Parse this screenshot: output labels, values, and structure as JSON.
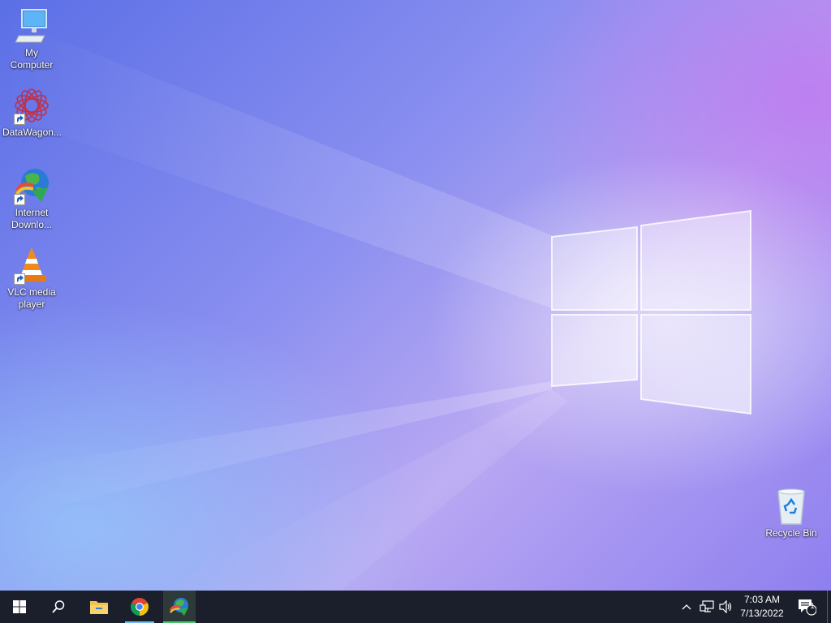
{
  "desktop": {
    "icons": [
      {
        "label": "My Computer"
      },
      {
        "label": "DataWagon..."
      },
      {
        "label_line1": "Internet",
        "label_line2": "Downlo..."
      },
      {
        "label_line1": "VLC media",
        "label_line2": "player"
      },
      {
        "label": "Recycle Bin"
      }
    ]
  },
  "taskbar": {
    "pinned": [
      "start-button",
      "search-button",
      "file-explorer",
      "chrome",
      "internet-download-manager"
    ],
    "clock": {
      "time": "7:03 AM",
      "date": "7/13/2022"
    },
    "notifications": {
      "count": "1"
    }
  },
  "colors": {
    "taskbar_bg": "#1b1e2b",
    "active_underline": "#4ac96a",
    "chrome_underline": "#76b9ed"
  }
}
